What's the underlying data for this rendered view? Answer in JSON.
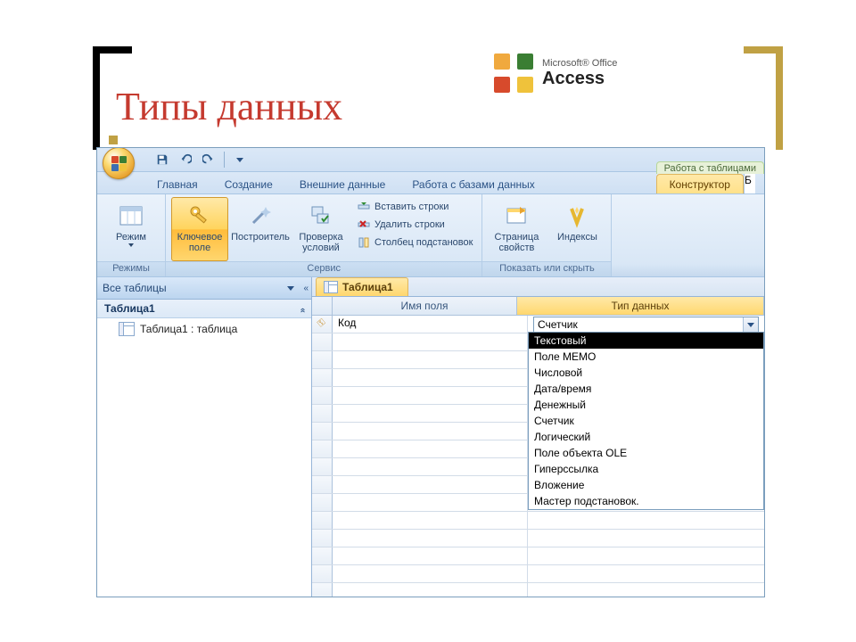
{
  "slide": {
    "title": "Типы данных"
  },
  "badge": {
    "line1": "Microsoft® Office",
    "line2": "Access"
  },
  "ribbon_tabs": {
    "main": "Главная",
    "create": "Создание",
    "external": "Внешние данные",
    "dbtools": "Работа с базами данных"
  },
  "context": {
    "group": "Работа с таблицами",
    "tab": "Конструктор",
    "cutoff": "Б"
  },
  "ribbon": {
    "groups": {
      "modes": {
        "label": "Режимы",
        "view": "Режим"
      },
      "service": {
        "label": "Сервис",
        "key": "Ключевое поле",
        "builder": "Построитель",
        "validate": "Проверка условий",
        "insert_rows": "Вставить строки",
        "delete_rows": "Удалить строки",
        "lookup_col": "Столбец  подстановок"
      },
      "show": {
        "label": "Показать или скрыть",
        "prop_page": "Страница свойств",
        "indexes": "Индексы"
      }
    }
  },
  "nav": {
    "header": "Все таблицы",
    "group": "Таблица1",
    "item": "Таблица1 : таблица"
  },
  "doc": {
    "tab": "Таблица1"
  },
  "columns": {
    "name": "Имя поля",
    "type": "Тип данных"
  },
  "row1": {
    "name": "Код",
    "type": "Счетчик"
  },
  "type_options": [
    "Текстовый",
    "Поле МЕМО",
    "Числовой",
    "Дата/время",
    "Денежный",
    "Счетчик",
    "Логический",
    "Поле объекта OLE",
    "Гиперссылка",
    "Вложение",
    "Мастер подстановок."
  ]
}
